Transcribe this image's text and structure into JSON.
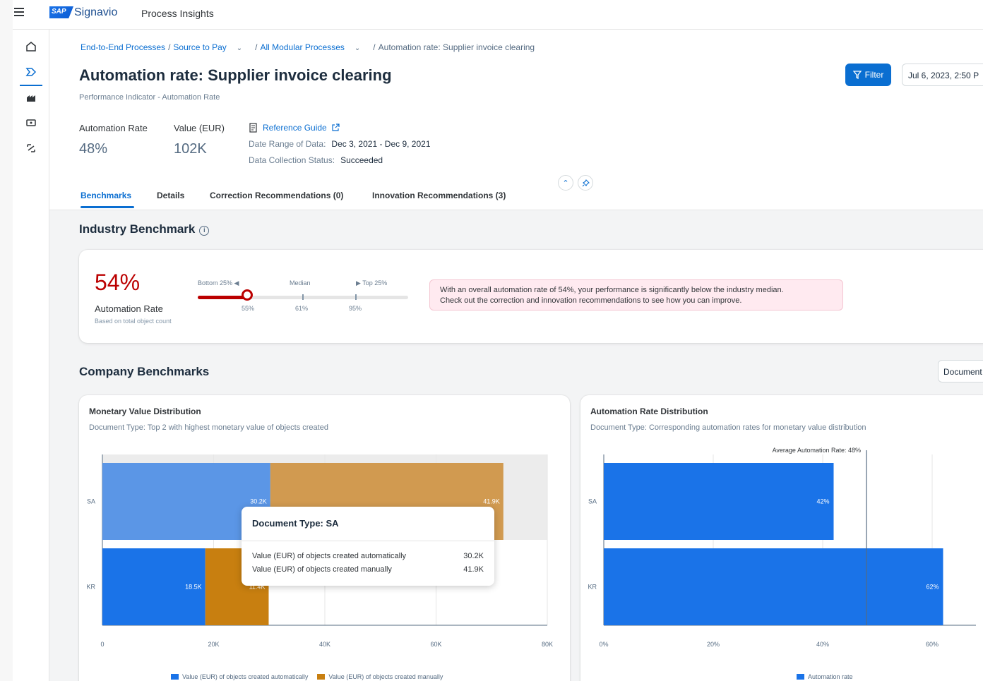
{
  "shell": {
    "logo_text": "SAP",
    "brand": "Signavio",
    "app_title": "Process Insights"
  },
  "breadcrumb": {
    "items": [
      "End-to-End Processes",
      "Source to Pay",
      "All Modular Processes"
    ],
    "current": "Automation rate: Supplier invoice clearing"
  },
  "page": {
    "title": "Automation rate: Supplier invoice clearing",
    "subtitle": "Performance Indicator - Automation Rate"
  },
  "toolbar": {
    "filter_label": "Filter",
    "date_label": "Jul 6, 2023, 2:50 P"
  },
  "kpis": [
    {
      "label": "Automation Rate",
      "value": "48%"
    },
    {
      "label": "Value (EUR)",
      "value": "102K"
    }
  ],
  "meta": {
    "reference_guide": "Reference Guide",
    "date_range_label": "Date Range of Data:",
    "date_range_value": "Dec 3, 2021 - Dec 9, 2021",
    "status_label": "Data Collection Status:",
    "status_value": "Succeeded"
  },
  "tabs": [
    {
      "label": "Benchmarks",
      "active": true
    },
    {
      "label": "Details"
    },
    {
      "label": "Correction Recommendations (0)"
    },
    {
      "label": "Innovation Recommendations (3)"
    }
  ],
  "industry": {
    "title": "Industry Benchmark",
    "value": "54%",
    "label": "Automation Rate",
    "note": "Based on total object count",
    "scale_labels": {
      "bottom": "Bottom 25% ◀",
      "median": "Median",
      "top": "▶ Top 25%"
    },
    "scale_values": {
      "bottom": "55%",
      "median": "61%",
      "top": "95%"
    },
    "score": 54,
    "alert_line1": "With an overall automation rate of 54%, your performance is significantly below the industry median.",
    "alert_line2": "Check out the correction and innovation recommendations to see how you can improve."
  },
  "company": {
    "title": "Company Benchmarks",
    "document_button": "Document"
  },
  "monetary_card": {
    "title": "Monetary Value Distribution",
    "subtitle": "Document Type: Top 2 with highest monetary value of objects created"
  },
  "automation_card": {
    "title": "Automation Rate Distribution",
    "subtitle": "Document Type: Corresponding automation rates for monetary value distribution",
    "average_label": "Average Automation Rate: 48%"
  },
  "tooltip": {
    "title": "Document Type: SA",
    "rows": [
      {
        "label": "Value (EUR) of objects created automatically",
        "value": "30.2K"
      },
      {
        "label": "Value (EUR) of objects created manually",
        "value": "41.9K"
      }
    ]
  },
  "chart_data": [
    {
      "type": "bar",
      "orientation": "horizontal",
      "stacked": true,
      "categories": [
        "SA",
        "KR"
      ],
      "series": [
        {
          "name": "Value (EUR) of objects created automatically",
          "values": [
            30.2,
            18.5
          ],
          "labels": [
            "30.2K",
            "18.5K"
          ],
          "color": "#1a73e8"
        },
        {
          "name": "Value (EUR) of objects created manually",
          "values": [
            41.9,
            11.4
          ],
          "labels": [
            "41.9K",
            "11.4K"
          ],
          "color": "#c87f10"
        }
      ],
      "xticks": [
        "0",
        "20K",
        "40K",
        "60K",
        "80K"
      ],
      "xlim": [
        0,
        80
      ],
      "legend": "bottom",
      "highlighted_category": "SA"
    },
    {
      "type": "bar",
      "orientation": "horizontal",
      "categories": [
        "SA",
        "KR"
      ],
      "series": [
        {
          "name": "Automation rate",
          "values": [
            42,
            62
          ],
          "labels": [
            "42%",
            "62%"
          ],
          "color": "#1a73e8"
        }
      ],
      "xticks": [
        "0%",
        "20%",
        "40%",
        "60%"
      ],
      "xlim": [
        0,
        68
      ],
      "reference_line": 48,
      "legend": "bottom"
    }
  ]
}
